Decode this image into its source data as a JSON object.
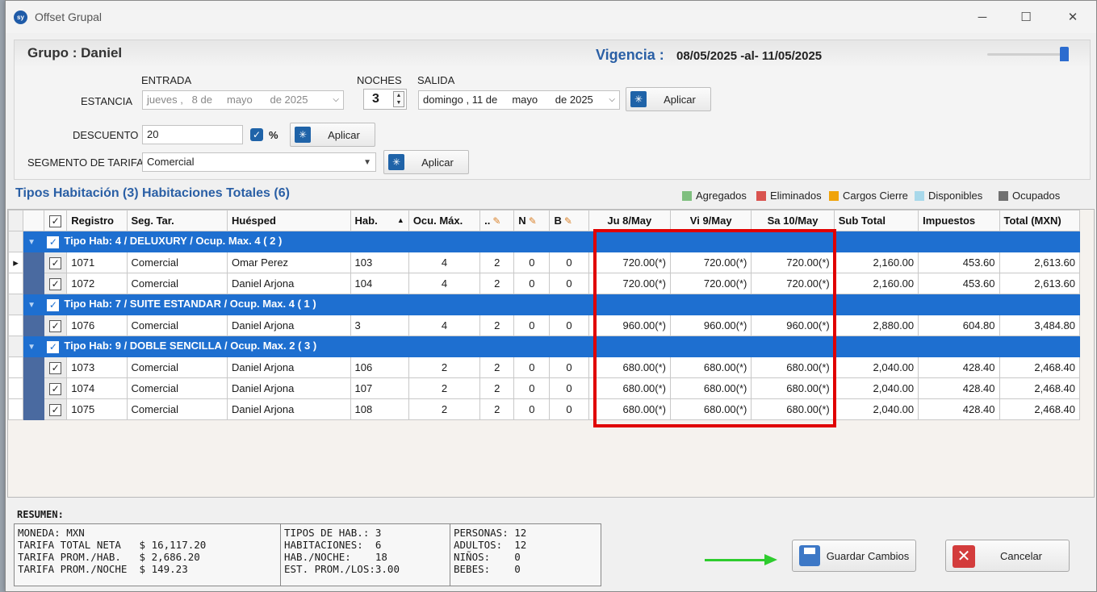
{
  "window": {
    "app_icon": "sy",
    "title": "Offset Grupal",
    "minimize": "─",
    "maximize": "☐",
    "close": "✕"
  },
  "header": {
    "group": "Grupo : Daniel",
    "vigencia_label": "Vigencia :",
    "vigencia_value": "08/05/2025 -al- 11/05/2025"
  },
  "estancia": {
    "label": "ESTANCIA",
    "entrada_label": "ENTRADA",
    "entrada_value": "jueves ,   8 de     mayo      de 2025",
    "noches_label": "NOCHES",
    "noches_value": "3",
    "salida_label": "SALIDA",
    "salida_value": "domingo , 11 de     mayo      de 2025",
    "apply_label": "Aplicar"
  },
  "descuento": {
    "label": "DESCUENTO",
    "value": "20",
    "percent_label": "%",
    "apply_label": "Aplicar"
  },
  "segmento": {
    "label": "SEGMENTO DE TARIFA",
    "value": "Comercial",
    "apply_label": "Aplicar"
  },
  "tipos_title": "Tipos Habitación (3) Habitaciones Totales (6)",
  "legend": [
    {
      "label": "Agregados",
      "color": "#7fbf7f"
    },
    {
      "label": "Eliminados",
      "color": "#d9534f"
    },
    {
      "label": "Cargos Cierre",
      "color": "#f0a30a"
    },
    {
      "label": "Disponibles",
      "color": "#a8d8ea"
    },
    {
      "label": "Ocupados",
      "color": "#707070"
    }
  ],
  "columns": {
    "registro": "Registro",
    "seg": "Seg. Tar.",
    "huesped": "Huésped",
    "hab": "Hab.",
    "ocu": "Ocu. Máx.",
    "a": "..",
    "n": "N",
    "b": "B",
    "d1": "Ju 8/May",
    "d2": "Vi 9/May",
    "d3": "Sa 10/May",
    "sub": "Sub Total",
    "imp": "Impuestos",
    "total": "Total (MXN)"
  },
  "groups": [
    {
      "label": "Tipo Hab: 4 / DELUXURY / Ocup. Max. 4 ( 2 )",
      "rows": [
        {
          "registro": "1071",
          "seg": "Comercial",
          "huesped": "Omar Perez",
          "hab": "103",
          "ocu": "4",
          "a": "2",
          "n": "0",
          "b": "0",
          "d1": "720.00(*)",
          "d2": "720.00(*)",
          "d3": "720.00(*)",
          "sub": "2,160.00",
          "imp": "453.60",
          "total": "2,613.60"
        },
        {
          "registro": "1072",
          "seg": "Comercial",
          "huesped": "Daniel Arjona",
          "hab": "104",
          "ocu": "4",
          "a": "2",
          "n": "0",
          "b": "0",
          "d1": "720.00(*)",
          "d2": "720.00(*)",
          "d3": "720.00(*)",
          "sub": "2,160.00",
          "imp": "453.60",
          "total": "2,613.60"
        }
      ]
    },
    {
      "label": "Tipo Hab: 7 / SUITE ESTANDAR / Ocup. Max. 4 ( 1 )",
      "rows": [
        {
          "registro": "1076",
          "seg": "Comercial",
          "huesped": "Daniel Arjona",
          "hab": "3",
          "ocu": "4",
          "a": "2",
          "n": "0",
          "b": "0",
          "d1": "960.00(*)",
          "d2": "960.00(*)",
          "d3": "960.00(*)",
          "sub": "2,880.00",
          "imp": "604.80",
          "total": "3,484.80"
        }
      ]
    },
    {
      "label": "Tipo Hab: 9 / DOBLE SENCILLA / Ocup. Max. 2 ( 3 )",
      "rows": [
        {
          "registro": "1073",
          "seg": "Comercial",
          "huesped": "Daniel Arjona",
          "hab": "106",
          "ocu": "2",
          "a": "2",
          "n": "0",
          "b": "0",
          "d1": "680.00(*)",
          "d2": "680.00(*)",
          "d3": "680.00(*)",
          "sub": "2,040.00",
          "imp": "428.40",
          "total": "2,468.40"
        },
        {
          "registro": "1074",
          "seg": "Comercial",
          "huesped": "Daniel Arjona",
          "hab": "107",
          "ocu": "2",
          "a": "2",
          "n": "0",
          "b": "0",
          "d1": "680.00(*)",
          "d2": "680.00(*)",
          "d3": "680.00(*)",
          "sub": "2,040.00",
          "imp": "428.40",
          "total": "2,468.40"
        },
        {
          "registro": "1075",
          "seg": "Comercial",
          "huesped": "Daniel Arjona",
          "hab": "108",
          "ocu": "2",
          "a": "2",
          "n": "0",
          "b": "0",
          "d1": "680.00(*)",
          "d2": "680.00(*)",
          "d3": "680.00(*)",
          "sub": "2,040.00",
          "imp": "428.40",
          "total": "2,468.40"
        }
      ]
    }
  ],
  "resumen": {
    "label": "RESUMEN:",
    "col1": [
      "MONEDA: MXN",
      "TARIFA TOTAL NETA   $ 16,117.20",
      "TARIFA PROM./HAB.   $ 2,686.20",
      "TARIFA PROM./NOCHE  $ 149.23"
    ],
    "col2": [
      "TIPOS DE HAB.: 3",
      "HABITACIONES:  6",
      "HAB./NOCHE:    18",
      "EST. PROM./LOS:3.00"
    ],
    "col3": [
      "PERSONAS: 12",
      "ADULTOS:  12",
      "NIÑOS:    0",
      "BEBES:    0"
    ]
  },
  "buttons": {
    "save": "Guardar Cambios",
    "cancel": "Cancelar"
  }
}
